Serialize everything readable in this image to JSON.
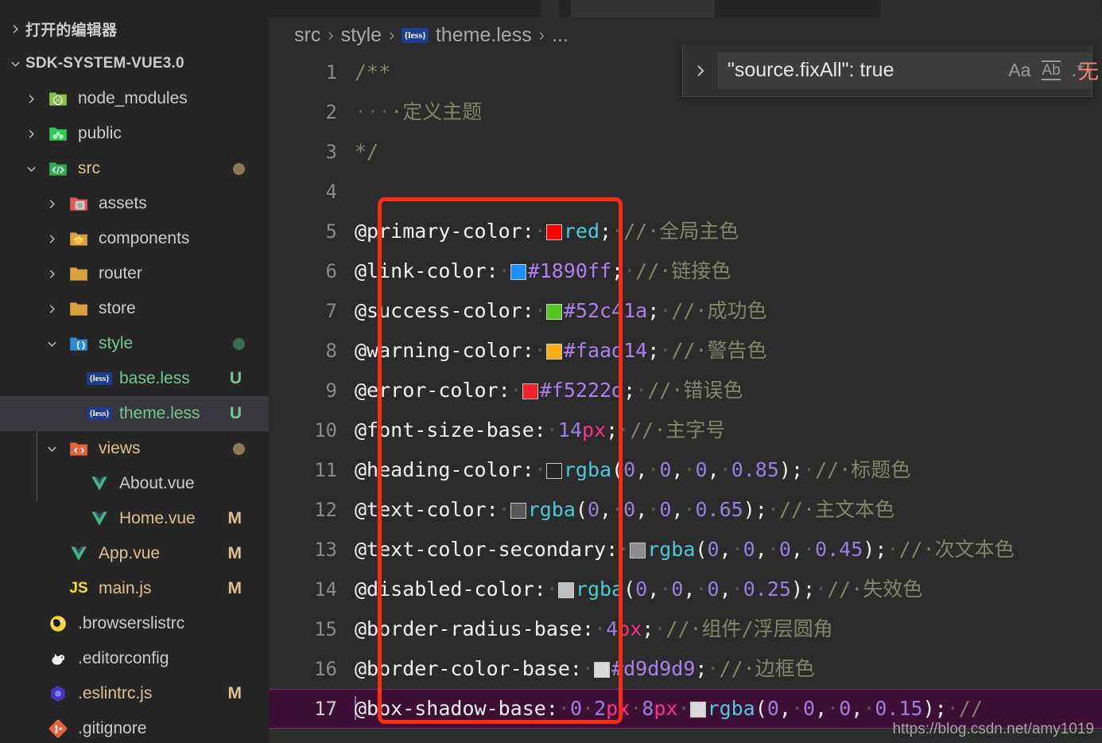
{
  "window": {
    "tabs_visible": true
  },
  "sidebar": {
    "sections": [
      {
        "label": "打开的编辑器",
        "expanded": false
      },
      {
        "label": "SDK-SYSTEM-VUE3.0",
        "expanded": true
      }
    ],
    "items": [
      {
        "label": "node_modules",
        "icon": "folder-node-icon",
        "indent": 1,
        "twisty": "chevron-right",
        "badge": "",
        "dot": "",
        "color": "default"
      },
      {
        "label": "public",
        "icon": "folder-public-icon",
        "indent": 1,
        "twisty": "chevron-right",
        "badge": "",
        "dot": "",
        "color": "default"
      },
      {
        "label": "src",
        "icon": "folder-src-icon",
        "indent": 1,
        "twisty": "chevron-down",
        "badge": "",
        "dot": "#8c7b52",
        "color": "mod"
      },
      {
        "label": "assets",
        "icon": "folder-assets-icon",
        "indent": 2,
        "twisty": "chevron-right",
        "badge": "",
        "dot": "",
        "color": "default"
      },
      {
        "label": "components",
        "icon": "folder-components-icon",
        "indent": 2,
        "twisty": "chevron-right",
        "badge": "",
        "dot": "",
        "color": "default"
      },
      {
        "label": "router",
        "icon": "folder-icon",
        "indent": 2,
        "twisty": "chevron-right",
        "badge": "",
        "dot": "",
        "color": "default"
      },
      {
        "label": "store",
        "icon": "folder-icon",
        "indent": 2,
        "twisty": "chevron-right",
        "badge": "",
        "dot": "",
        "color": "default"
      },
      {
        "label": "style",
        "icon": "folder-style-icon",
        "indent": 2,
        "twisty": "chevron-down",
        "badge": "",
        "dot": "#3a6b4a",
        "color": "unt"
      },
      {
        "label": "base.less",
        "icon": "less-file-icon",
        "indent": 3,
        "twisty": "",
        "badge": "U",
        "dot": "",
        "color": "unt"
      },
      {
        "label": "theme.less",
        "icon": "less-file-icon",
        "indent": 3,
        "twisty": "",
        "badge": "U",
        "dot": "",
        "color": "unt",
        "selected": true
      },
      {
        "label": "views",
        "icon": "folder-views-icon",
        "indent": 2,
        "twisty": "chevron-down",
        "badge": "",
        "dot": "#8c7b52",
        "color": "mod"
      },
      {
        "label": "About.vue",
        "icon": "vue-file-icon",
        "indent": 3,
        "twisty": "",
        "badge": "",
        "dot": "",
        "color": "default"
      },
      {
        "label": "Home.vue",
        "icon": "vue-file-icon",
        "indent": 3,
        "twisty": "",
        "badge": "M",
        "dot": "",
        "color": "mod"
      },
      {
        "label": "App.vue",
        "icon": "vue-file-icon",
        "indent": 2,
        "twisty": "",
        "badge": "M",
        "dot": "",
        "color": "mod"
      },
      {
        "label": "main.js",
        "icon": "js-file-icon",
        "indent": 2,
        "twisty": "",
        "badge": "M",
        "dot": "",
        "color": "mod"
      },
      {
        "label": ".browserslistrc",
        "icon": "browserslist-icon",
        "indent": 1,
        "twisty": "",
        "badge": "",
        "dot": "",
        "color": "default"
      },
      {
        "label": ".editorconfig",
        "icon": "editorconfig-icon",
        "indent": 1,
        "twisty": "",
        "badge": "",
        "dot": "",
        "color": "default"
      },
      {
        "label": ".eslintrc.js",
        "icon": "eslint-icon",
        "indent": 1,
        "twisty": "",
        "badge": "M",
        "dot": "",
        "color": "mod"
      },
      {
        "label": ".gitignore",
        "icon": "git-icon",
        "indent": 1,
        "twisty": "",
        "badge": "",
        "dot": "",
        "color": "default"
      }
    ]
  },
  "breadcrumb": {
    "parts": [
      "src",
      "style",
      "theme.less",
      "..."
    ],
    "file_icon": "less-file-icon",
    "separator": "›"
  },
  "find": {
    "toggle_icon": "chevron-right",
    "query": "\"source.fixAll\": true",
    "options": [
      {
        "name": "match-case-icon",
        "label": "Aa"
      },
      {
        "name": "whole-word-icon",
        "label": "Ab"
      },
      {
        "name": "regex-icon",
        "label": ".*"
      }
    ],
    "no_results": "无"
  },
  "editor": {
    "filename": "theme.less",
    "language": "less",
    "current_line": 17,
    "lines": [
      {
        "n": "1",
        "tokens": [
          {
            "t": "cmt",
            "v": "/**"
          }
        ]
      },
      {
        "n": "2",
        "tokens": [
          {
            "t": "dot",
            "v": "·"
          },
          {
            "t": "dot",
            "v": "·"
          },
          {
            "t": "dot",
            "v": "·"
          },
          {
            "t": "cmt",
            "v": "·定义主题"
          }
        ]
      },
      {
        "n": "3",
        "tokens": [
          {
            "t": "cmt",
            "v": "*/"
          }
        ]
      },
      {
        "n": "4",
        "tokens": []
      },
      {
        "n": "5",
        "tokens": [
          {
            "t": "var",
            "v": "@primary-color:"
          },
          {
            "t": "dot",
            "v": "·"
          },
          {
            "t": "swatch",
            "v": "#ff0000"
          },
          {
            "t": "kw",
            "v": "red"
          },
          {
            "t": "punct",
            "v": ";"
          },
          {
            "t": "dot",
            "v": "·"
          },
          {
            "t": "cmt",
            "v": "//·全局主色"
          }
        ]
      },
      {
        "n": "6",
        "tokens": [
          {
            "t": "var",
            "v": "@link-color:"
          },
          {
            "t": "dot",
            "v": "·"
          },
          {
            "t": "swatch",
            "v": "#1890ff"
          },
          {
            "t": "hex",
            "v": "#1890ff"
          },
          {
            "t": "punct",
            "v": ";"
          },
          {
            "t": "dot",
            "v": "·"
          },
          {
            "t": "cmt",
            "v": "//·链接色"
          }
        ]
      },
      {
        "n": "7",
        "tokens": [
          {
            "t": "var",
            "v": "@success-color:"
          },
          {
            "t": "dot",
            "v": "·"
          },
          {
            "t": "swatch",
            "v": "#52c41a"
          },
          {
            "t": "hex",
            "v": "#52c41a"
          },
          {
            "t": "punct",
            "v": ";"
          },
          {
            "t": "dot",
            "v": "·"
          },
          {
            "t": "cmt",
            "v": "//·成功色"
          }
        ]
      },
      {
        "n": "8",
        "tokens": [
          {
            "t": "var",
            "v": "@warning-color:"
          },
          {
            "t": "dot",
            "v": "·"
          },
          {
            "t": "swatch",
            "v": "#faad14"
          },
          {
            "t": "hex",
            "v": "#faad14"
          },
          {
            "t": "punct",
            "v": ";"
          },
          {
            "t": "dot",
            "v": "·"
          },
          {
            "t": "cmt",
            "v": "//·警告色"
          }
        ]
      },
      {
        "n": "9",
        "tokens": [
          {
            "t": "var",
            "v": "@error-color:"
          },
          {
            "t": "dot",
            "v": "·"
          },
          {
            "t": "swatch",
            "v": "#f5222d"
          },
          {
            "t": "hex",
            "v": "#f5222d"
          },
          {
            "t": "punct",
            "v": ";"
          },
          {
            "t": "dot",
            "v": "·"
          },
          {
            "t": "cmt",
            "v": "//·错误色"
          }
        ]
      },
      {
        "n": "10",
        "tokens": [
          {
            "t": "var",
            "v": "@font-size-base:"
          },
          {
            "t": "dot",
            "v": "·"
          },
          {
            "t": "num",
            "v": "14"
          },
          {
            "t": "unit",
            "v": "px"
          },
          {
            "t": "punct",
            "v": ";"
          },
          {
            "t": "dot",
            "v": "·"
          },
          {
            "t": "cmt",
            "v": "//·主字号"
          }
        ]
      },
      {
        "n": "11",
        "tokens": [
          {
            "t": "var",
            "v": "@heading-color:"
          },
          {
            "t": "dot",
            "v": "·"
          },
          {
            "t": "swatch",
            "v": "#262626"
          },
          {
            "t": "fn",
            "v": "rgba"
          },
          {
            "t": "punct",
            "v": "("
          },
          {
            "t": "num",
            "v": "0"
          },
          {
            "t": "punct",
            "v": ","
          },
          {
            "t": "dot",
            "v": "·"
          },
          {
            "t": "num",
            "v": "0"
          },
          {
            "t": "punct",
            "v": ","
          },
          {
            "t": "dot",
            "v": "·"
          },
          {
            "t": "num",
            "v": "0"
          },
          {
            "t": "punct",
            "v": ","
          },
          {
            "t": "dot",
            "v": "·"
          },
          {
            "t": "num",
            "v": "0.85"
          },
          {
            "t": "punct",
            "v": ");"
          },
          {
            "t": "dot",
            "v": "·"
          },
          {
            "t": "cmt",
            "v": "//·标题色"
          }
        ]
      },
      {
        "n": "12",
        "tokens": [
          {
            "t": "var",
            "v": "@text-color:"
          },
          {
            "t": "dot",
            "v": "·"
          },
          {
            "t": "swatch",
            "v": "#595959"
          },
          {
            "t": "fn",
            "v": "rgba"
          },
          {
            "t": "punct",
            "v": "("
          },
          {
            "t": "num",
            "v": "0"
          },
          {
            "t": "punct",
            "v": ","
          },
          {
            "t": "dot",
            "v": "·"
          },
          {
            "t": "num",
            "v": "0"
          },
          {
            "t": "punct",
            "v": ","
          },
          {
            "t": "dot",
            "v": "·"
          },
          {
            "t": "num",
            "v": "0"
          },
          {
            "t": "punct",
            "v": ","
          },
          {
            "t": "dot",
            "v": "·"
          },
          {
            "t": "num",
            "v": "0.65"
          },
          {
            "t": "punct",
            "v": ");"
          },
          {
            "t": "dot",
            "v": "·"
          },
          {
            "t": "cmt",
            "v": "//·主文本色"
          }
        ]
      },
      {
        "n": "13",
        "tokens": [
          {
            "t": "var",
            "v": "@text-color-secondary:"
          },
          {
            "t": "dot",
            "v": "·"
          },
          {
            "t": "swatch",
            "v": "#8c8c8c"
          },
          {
            "t": "fn",
            "v": "rgba"
          },
          {
            "t": "punct",
            "v": "("
          },
          {
            "t": "num",
            "v": "0"
          },
          {
            "t": "punct",
            "v": ","
          },
          {
            "t": "dot",
            "v": "·"
          },
          {
            "t": "num",
            "v": "0"
          },
          {
            "t": "punct",
            "v": ","
          },
          {
            "t": "dot",
            "v": "·"
          },
          {
            "t": "num",
            "v": "0"
          },
          {
            "t": "punct",
            "v": ","
          },
          {
            "t": "dot",
            "v": "·"
          },
          {
            "t": "num",
            "v": "0.45"
          },
          {
            "t": "punct",
            "v": ");"
          },
          {
            "t": "dot",
            "v": "·"
          },
          {
            "t": "cmt",
            "v": "//·次文本色"
          }
        ]
      },
      {
        "n": "14",
        "tokens": [
          {
            "t": "var",
            "v": "@disabled-color:"
          },
          {
            "t": "dot",
            "v": "·"
          },
          {
            "t": "swatch",
            "v": "#bfbfbf"
          },
          {
            "t": "fn",
            "v": "rgba"
          },
          {
            "t": "punct",
            "v": "("
          },
          {
            "t": "num",
            "v": "0"
          },
          {
            "t": "punct",
            "v": ","
          },
          {
            "t": "dot",
            "v": "·"
          },
          {
            "t": "num",
            "v": "0"
          },
          {
            "t": "punct",
            "v": ","
          },
          {
            "t": "dot",
            "v": "·"
          },
          {
            "t": "num",
            "v": "0"
          },
          {
            "t": "punct",
            "v": ","
          },
          {
            "t": "dot",
            "v": "·"
          },
          {
            "t": "num",
            "v": "0.25"
          },
          {
            "t": "punct",
            "v": ");"
          },
          {
            "t": "dot",
            "v": "·"
          },
          {
            "t": "cmt",
            "v": "//·失效色"
          }
        ]
      },
      {
        "n": "15",
        "tokens": [
          {
            "t": "var",
            "v": "@border-radius-base:"
          },
          {
            "t": "dot",
            "v": "·"
          },
          {
            "t": "num",
            "v": "4"
          },
          {
            "t": "unit",
            "v": "px"
          },
          {
            "t": "punct",
            "v": ";"
          },
          {
            "t": "dot",
            "v": "·"
          },
          {
            "t": "cmt",
            "v": "//·组件/浮层圆角"
          }
        ]
      },
      {
        "n": "16",
        "tokens": [
          {
            "t": "var",
            "v": "@border-color-base:"
          },
          {
            "t": "dot",
            "v": "·"
          },
          {
            "t": "swatch",
            "v": "#d9d9d9"
          },
          {
            "t": "hex",
            "v": "#d9d9d9"
          },
          {
            "t": "punct",
            "v": ";"
          },
          {
            "t": "dot",
            "v": "·"
          },
          {
            "t": "cmt",
            "v": "//·边框色"
          }
        ]
      },
      {
        "n": "17",
        "current": true,
        "tokens": [
          {
            "t": "cursor",
            "v": ""
          },
          {
            "t": "var",
            "v": "@box-shadow-base:"
          },
          {
            "t": "dot",
            "v": "·"
          },
          {
            "t": "num",
            "v": "0"
          },
          {
            "t": "dot",
            "v": "·"
          },
          {
            "t": "num",
            "v": "2"
          },
          {
            "t": "unit",
            "v": "px"
          },
          {
            "t": "dot",
            "v": "·"
          },
          {
            "t": "num",
            "v": "8"
          },
          {
            "t": "unit",
            "v": "px"
          },
          {
            "t": "dot",
            "v": "·"
          },
          {
            "t": "swatch",
            "v": "#d9d9d9"
          },
          {
            "t": "fn",
            "v": "rgba"
          },
          {
            "t": "punct",
            "v": "("
          },
          {
            "t": "num",
            "v": "0"
          },
          {
            "t": "punct",
            "v": ","
          },
          {
            "t": "dot",
            "v": "·"
          },
          {
            "t": "num",
            "v": "0"
          },
          {
            "t": "punct",
            "v": ","
          },
          {
            "t": "dot",
            "v": "·"
          },
          {
            "t": "num",
            "v": "0"
          },
          {
            "t": "punct",
            "v": ","
          },
          {
            "t": "dot",
            "v": "·"
          },
          {
            "t": "num",
            "v": "0.15"
          },
          {
            "t": "punct",
            "v": ");"
          },
          {
            "t": "dot",
            "v": "·"
          },
          {
            "t": "cmt",
            "v": "//"
          }
        ]
      }
    ]
  },
  "annotation": {
    "type": "rectangle",
    "color": "#ff2d10"
  },
  "watermark": {
    "text": "https://blog.csdn.net/amy1019"
  }
}
